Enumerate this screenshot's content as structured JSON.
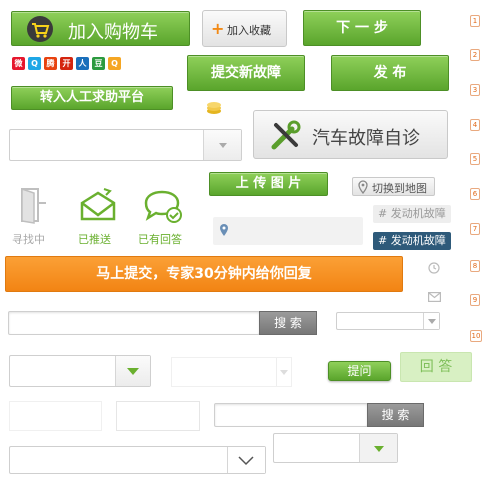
{
  "cart_button": "加入购物车",
  "favorite_button": "加入收藏",
  "next_button": "下 一 步",
  "submit_fault_button": "提交新故障",
  "publish_button": "发 布",
  "manual_help_button": "转入人工求助平台",
  "self_diagnose_button": "汽车故障自诊",
  "upload_button": "上 传 图 片",
  "switch_map_button": "切换到地图",
  "status_icons": [
    {
      "label": "寻找中"
    },
    {
      "label": "已推送"
    },
    {
      "label": "已有回答"
    }
  ],
  "tags": [
    "# 发动机故障",
    "# 发动机故障"
  ],
  "banner": "马上提交，专家30分钟内给你回复",
  "search_label_1": "搜 索",
  "search_label_2": "搜 索",
  "ask_button": "提问",
  "answer_button": "回 答",
  "step_numbers": [
    "1",
    "2",
    "3",
    "4",
    "5",
    "6",
    "7",
    "8",
    "9",
    "10"
  ],
  "social_icons": [
    {
      "name": "weibo",
      "glyph": "微",
      "color": "#e6162d"
    },
    {
      "name": "qzone",
      "glyph": "Q",
      "color": "#1ea7e6"
    },
    {
      "name": "tencent",
      "glyph": "腾",
      "color": "#e8420f"
    },
    {
      "name": "kaixin",
      "glyph": "开",
      "color": "#d4250f"
    },
    {
      "name": "renren",
      "glyph": "人",
      "color": "#1a6fbb"
    },
    {
      "name": "douban",
      "glyph": "豆",
      "color": "#2c9a3f"
    },
    {
      "name": "qq",
      "glyph": "Q",
      "color": "#f5a623"
    }
  ],
  "colors": {
    "green": "#6ab02f",
    "orange": "#f7941d",
    "dark_tag": "#2e5a7a",
    "num_orange": "#e06a1b"
  }
}
